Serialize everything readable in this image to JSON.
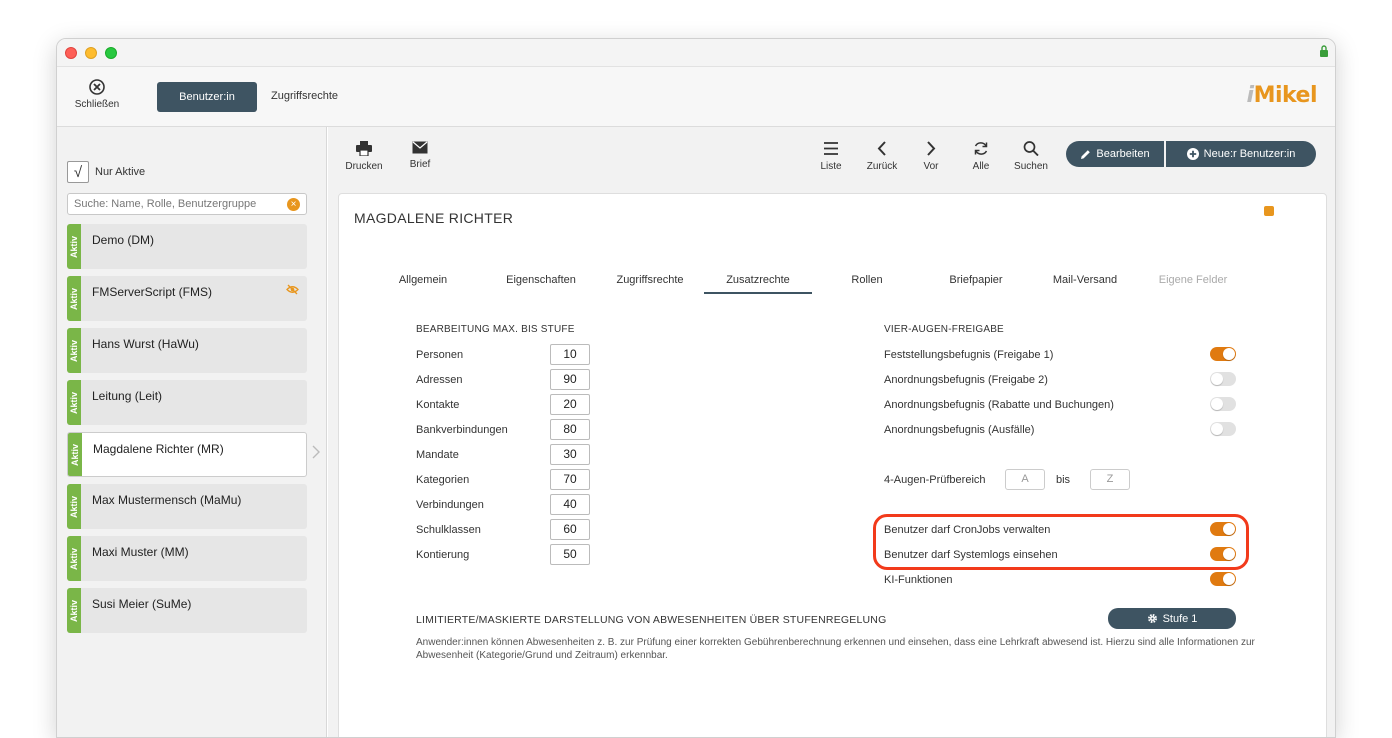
{
  "topbar": {
    "close_label": "Schließen",
    "tab_user": "Benutzer:in",
    "tab_rights": "Zugriffsrechte",
    "logo_i": "i",
    "logo_text": "Mikel"
  },
  "sidebar": {
    "only_active_label": "Nur Aktive",
    "only_active_check": "√",
    "search_placeholder": "Suche: Name, Rolle, Benutzergruppe",
    "badge_label": "Aktiv",
    "users": [
      {
        "name": "Demo (DM)"
      },
      {
        "name": "FMServerScript (FMS)"
      },
      {
        "name": "Hans Wurst (HaWu)"
      },
      {
        "name": "Leitung (Leit)"
      },
      {
        "name": "Magdalene Richter (MR)"
      },
      {
        "name": "Max Mustermensch (MaMu)"
      },
      {
        "name": "Maxi Muster (MM)"
      },
      {
        "name": "Susi Meier (SuMe)"
      }
    ]
  },
  "toolbar": {
    "print": "Drucken",
    "letter": "Brief",
    "list": "Liste",
    "back": "Zurück",
    "next": "Vor",
    "all": "Alle",
    "search": "Suchen",
    "edit": "Bearbeiten",
    "new_user": "Neue:r Benutzer:in"
  },
  "detail": {
    "name": "MAGDALENE RICHTER",
    "tabs": [
      "Allgemein",
      "Eigenschaften",
      "Zugriffsrechte",
      "Zusatzrechte",
      "Rollen",
      "Briefpapier",
      "Mail-Versand",
      "Eigene Felder"
    ],
    "levels_title": "BEARBEITUNG MAX. BIS STUFE",
    "levels": [
      {
        "label": "Personen",
        "value": "10"
      },
      {
        "label": "Adressen",
        "value": "90"
      },
      {
        "label": "Kontakte",
        "value": "20"
      },
      {
        "label": "Bankverbindungen",
        "value": "80"
      },
      {
        "label": "Mandate",
        "value": "30"
      },
      {
        "label": "Kategorien",
        "value": "70"
      },
      {
        "label": "Verbindungen",
        "value": "40"
      },
      {
        "label": "Schulklassen",
        "value": "60"
      },
      {
        "label": "Kontierung",
        "value": "50"
      }
    ],
    "four_eyes_title": "VIER-AUGEN-FREIGABE",
    "four_eyes": [
      {
        "label": "Feststellungsbefugnis (Freigabe 1)",
        "on": true
      },
      {
        "label": "Anordnungsbefugnis (Freigabe 2)",
        "on": false
      },
      {
        "label": "Anordnungsbefugnis (Rabatte und Buchungen)",
        "on": false
      },
      {
        "label": "Anordnungsbefugnis (Ausfälle)",
        "on": false
      }
    ],
    "range_label": "4-Augen-Prüfbereich",
    "range_from": "A",
    "range_to_label": "bis",
    "range_to": "Z",
    "extra": [
      {
        "label": "Benutzer darf CronJobs verwalten",
        "on": true
      },
      {
        "label": "Benutzer darf Systemlogs einsehen",
        "on": true
      },
      {
        "label": "KI-Funktionen",
        "on": true
      }
    ],
    "limited_title": "LIMITIERTE/MASKIERTE DARSTELLUNG VON ABWESENHEITEN ÜBER STUFENREGELUNG",
    "stufe_button": "Stufe 1",
    "description": "Anwender:innen können Abwesenheiten z. B. zur Prüfung einer korrekten Gebührenberechnung erkennen und einsehen, dass eine Lehrkraft abwesend ist. Hierzu sind alle Informationen zur Abwesenheit (Kategorie/Grund und Zeitraum) erkennbar."
  },
  "colors": {
    "accent": "#3e5462",
    "toggle_on": "#e07a10",
    "active_badge": "#7ab648",
    "highlight": "#f23a1b"
  }
}
